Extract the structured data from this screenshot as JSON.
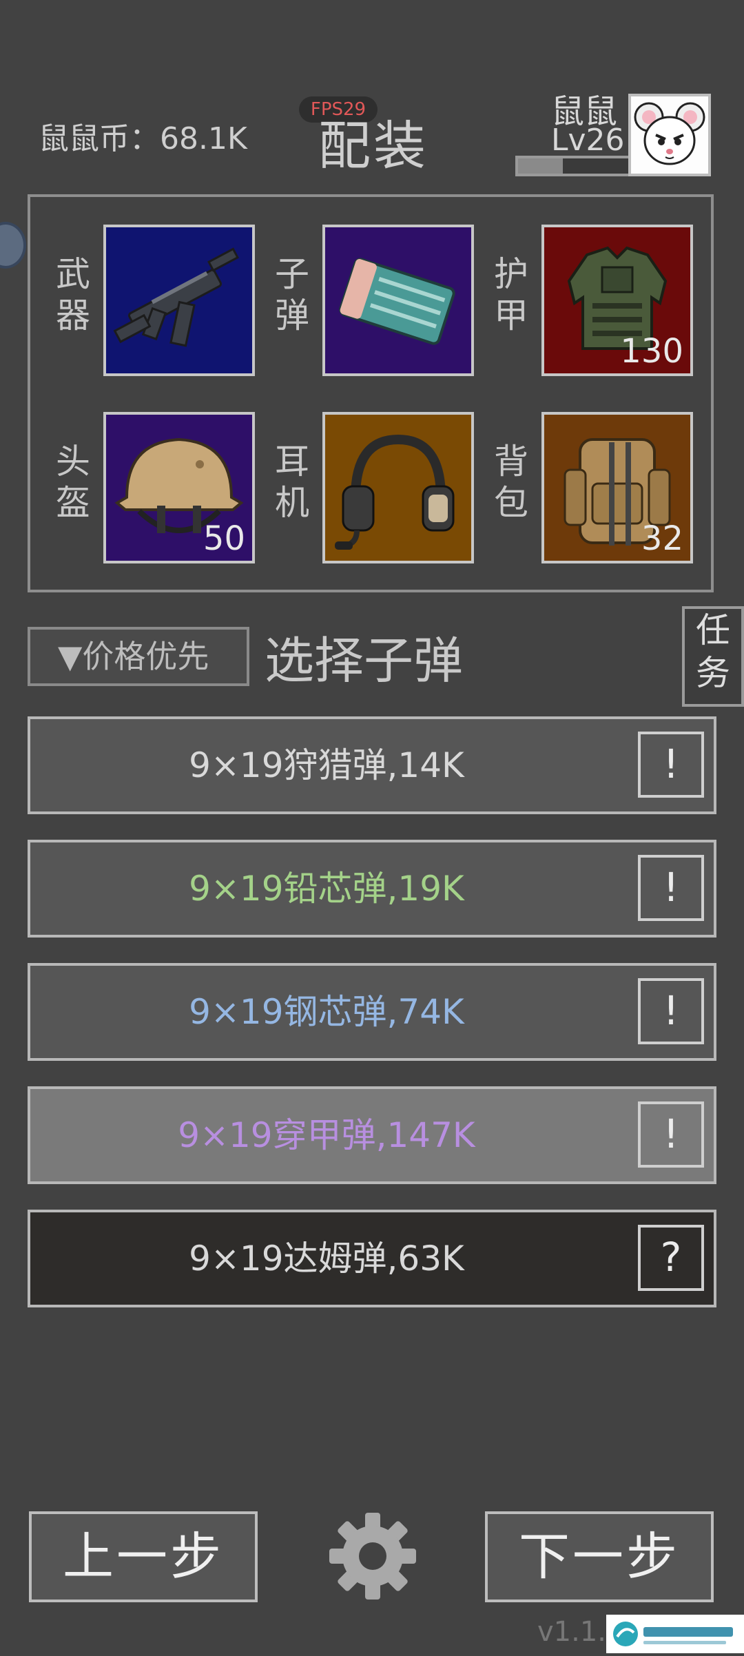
{
  "header": {
    "coins": "鼠鼠币：68.1K",
    "fps": "FPS29",
    "title": "配装",
    "player_name": "鼠鼠",
    "level": "Lv26",
    "xp_fraction": 0.4
  },
  "loadout": {
    "slots": [
      {
        "label": "武器",
        "item_icon": "smg-icon",
        "count": ""
      },
      {
        "label": "子弹",
        "item_icon": "ammo-box-icon",
        "count": ""
      },
      {
        "label": "护甲",
        "item_icon": "body-armor-icon",
        "count": "130"
      },
      {
        "label": "头盔",
        "item_icon": "helmet-icon",
        "count": "50"
      },
      {
        "label": "耳机",
        "item_icon": "headset-icon",
        "count": ""
      },
      {
        "label": "背包",
        "item_icon": "backpack-icon",
        "count": "32"
      }
    ]
  },
  "sort": {
    "button_label": "▼价格优先",
    "heading": "选择子弹"
  },
  "task_button": "任务",
  "ammo_list": [
    {
      "label": "9×19狩猎弹,14K",
      "color": "#d9d9d9",
      "bg": "#565656",
      "info": "!"
    },
    {
      "label": "9×19铅芯弹,19K",
      "color": "#a4d289",
      "bg": "#565656",
      "info": "!"
    },
    {
      "label": "9×19钢芯弹,74K",
      "color": "#95b7e3",
      "bg": "#565656",
      "info": "!"
    },
    {
      "label": "9×19穿甲弹,147K",
      "color": "#b88fe0",
      "bg": "#7a7a7a",
      "info": "!"
    },
    {
      "label": "9×19达姆弹,63K",
      "color": "#d9d9d9",
      "bg": "#2e2c2a",
      "info": "?"
    }
  ],
  "nav": {
    "prev": "上一步",
    "next": "下一步"
  },
  "version": "v1.1."
}
